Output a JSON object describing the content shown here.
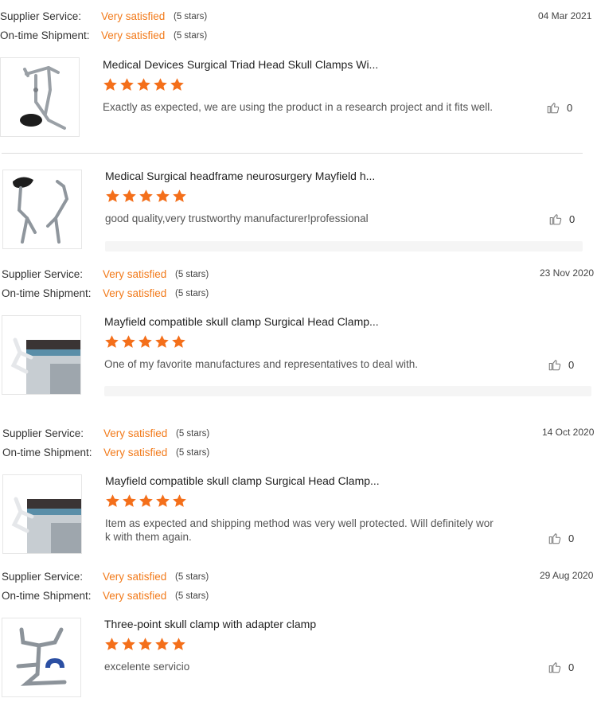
{
  "labels": {
    "supplier_service": "Supplier Service:",
    "ontime_shipment": "On-time Shipment:"
  },
  "reviews": [
    {
      "date": "04 Mar 2021",
      "supplier_rating": "Very satisfied",
      "supplier_stars": "(5 stars)",
      "shipment_rating": "Very satisfied",
      "shipment_stars": "(5 stars)",
      "product_title": "Medical Devices Surgical Triad Head Skull Clamps Wi...",
      "star_count": 5,
      "comment": "Exactly as expected, we are using the product in a research project and it fits well.",
      "likes": "0"
    },
    {
      "product_title": "Medical Surgical headframe neurosurgery Mayfield h...",
      "star_count": 5,
      "comment": "good quality,very trustworthy manufacturer!professional",
      "likes": "0"
    },
    {
      "date": "23 Nov 2020",
      "supplier_rating": "Very satisfied",
      "supplier_stars": "(5 stars)",
      "shipment_rating": "Very satisfied",
      "shipment_stars": "(5 stars)",
      "product_title": "Mayfield compatible skull clamp Surgical Head Clamp...",
      "star_count": 5,
      "comment": "One of my favorite manufactures and representatives to deal with.",
      "likes": "0"
    },
    {
      "date": "14 Oct 2020",
      "supplier_rating": "Very satisfied",
      "supplier_stars": "(5 stars)",
      "shipment_rating": "Very satisfied",
      "shipment_stars": "(5 stars)",
      "product_title": "Mayfield compatible skull clamp Surgical Head Clamp...",
      "star_count": 5,
      "comment_line1": "Item as expected and shipping method was very well protected. Will definitely wor",
      "comment_line2": "k with them again.",
      "likes": "0"
    },
    {
      "date": "29 Aug 2020",
      "supplier_rating": "Very satisfied",
      "supplier_stars": "(5 stars)",
      "shipment_rating": "Very satisfied",
      "shipment_stars": "(5 stars)",
      "product_title": "Three-point skull clamp with adapter clamp",
      "star_count": 5,
      "comment": "excelente servicio",
      "likes": "0"
    }
  ],
  "colors": {
    "accent_orange": "#f27a1a",
    "star_orange": "#f46f1a",
    "divider": "#dcdcdc"
  },
  "icons": {
    "star": "star-icon",
    "like": "thumbs-up-icon"
  }
}
